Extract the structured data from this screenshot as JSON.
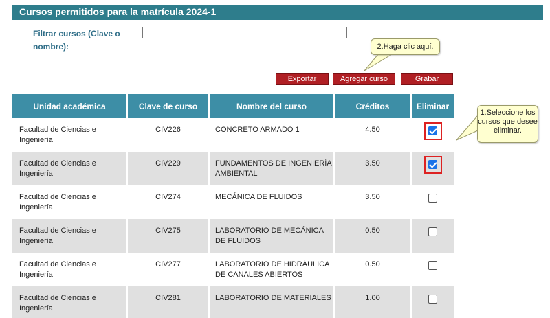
{
  "page_title": "Cursos permitidos para la matrícula 2024-1",
  "filter": {
    "label": "Filtrar cursos (Clave o nombre):",
    "value": "",
    "placeholder": ""
  },
  "buttons": {
    "exportar": "Exportar",
    "agregar": "Agregar curso",
    "grabar": "Grabar"
  },
  "tooltips": {
    "step2": "2.Haga clic aquí.",
    "step1": "1.Seleccione los cursos que desee eliminar."
  },
  "table": {
    "headers": [
      "Unidad académica",
      "Clave de curso",
      "Nombre del curso",
      "Créditos",
      "Eliminar"
    ],
    "rows": [
      {
        "unidad": "Facultad de Ciencias e Ingeniería",
        "clave": "CIV226",
        "nombre": "CONCRETO ARMADO 1",
        "creditos": "4.50",
        "eliminar": true
      },
      {
        "unidad": "Facultad de Ciencias e Ingeniería",
        "clave": "CIV229",
        "nombre": "FUNDAMENTOS DE INGENIERÍA AMBIENTAL",
        "creditos": "3.50",
        "eliminar": true
      },
      {
        "unidad": "Facultad de Ciencias e Ingeniería",
        "clave": "CIV274",
        "nombre": "MECÁNICA DE FLUIDOS",
        "creditos": "3.50",
        "eliminar": false
      },
      {
        "unidad": "Facultad de Ciencias e Ingeniería",
        "clave": "CIV275",
        "nombre": "LABORATORIO DE MECÁNICA DE FLUIDOS",
        "creditos": "0.50",
        "eliminar": false
      },
      {
        "unidad": "Facultad de Ciencias e Ingeniería",
        "clave": "CIV277",
        "nombre": "LABORATORIO DE HIDRÁULICA DE CANALES ABIERTOS",
        "creditos": "0.50",
        "eliminar": false
      },
      {
        "unidad": "Facultad de Ciencias e Ingeniería",
        "clave": "CIV281",
        "nombre": "LABORATORIO DE MATERIALES",
        "creditos": "1.00",
        "eliminar": false
      }
    ]
  },
  "colors": {
    "title_bar": "#2e7d8c",
    "table_header": "#3d8ea6",
    "button": "#b01f24",
    "tooltip": "#ffffd0",
    "highlight": "#dd2222"
  }
}
